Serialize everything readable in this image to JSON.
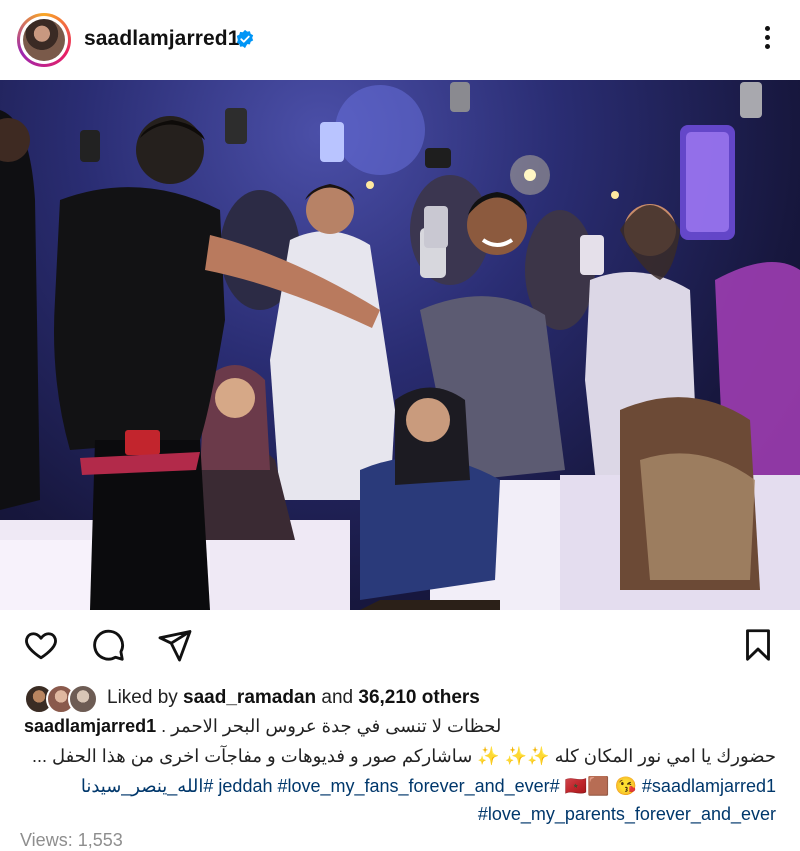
{
  "post": {
    "username": "saadlamjarred1",
    "verified": true
  },
  "icons": {
    "verified": "verified-badge-icon",
    "more": "more-options-icon",
    "like": "heart-icon",
    "comment": "comment-icon",
    "share": "paper-plane-icon",
    "save": "bookmark-icon"
  },
  "likes": {
    "prefix": "Liked by ",
    "user": "saad_ramadan",
    "middle": " and ",
    "count": "36,210 others"
  },
  "caption": {
    "user": "saadlamjarred1",
    "line1": "لحظات لا تنسى في جدة عروس البحر الاحمر .",
    "line2": "حضورك يا امي نور المكان كله ✨✨ ✨ ساشاركم صور و فديوهات و مفاجآت اخرى من هذا الحفل ...",
    "line3_tags": "#jeddah #love_my_fans_forever_and_ever #الله_ينصر_سيدنا",
    "line3_mid": " 🇲🇦🟫 😘 ",
    "line3_end": "#saadlamjarred1",
    "line4": "#love_my_parents_forever_and_ever"
  },
  "views": {
    "label": "Views: 1,553"
  },
  "colors": {
    "link": "#00376b",
    "verified": "#0095f6"
  }
}
